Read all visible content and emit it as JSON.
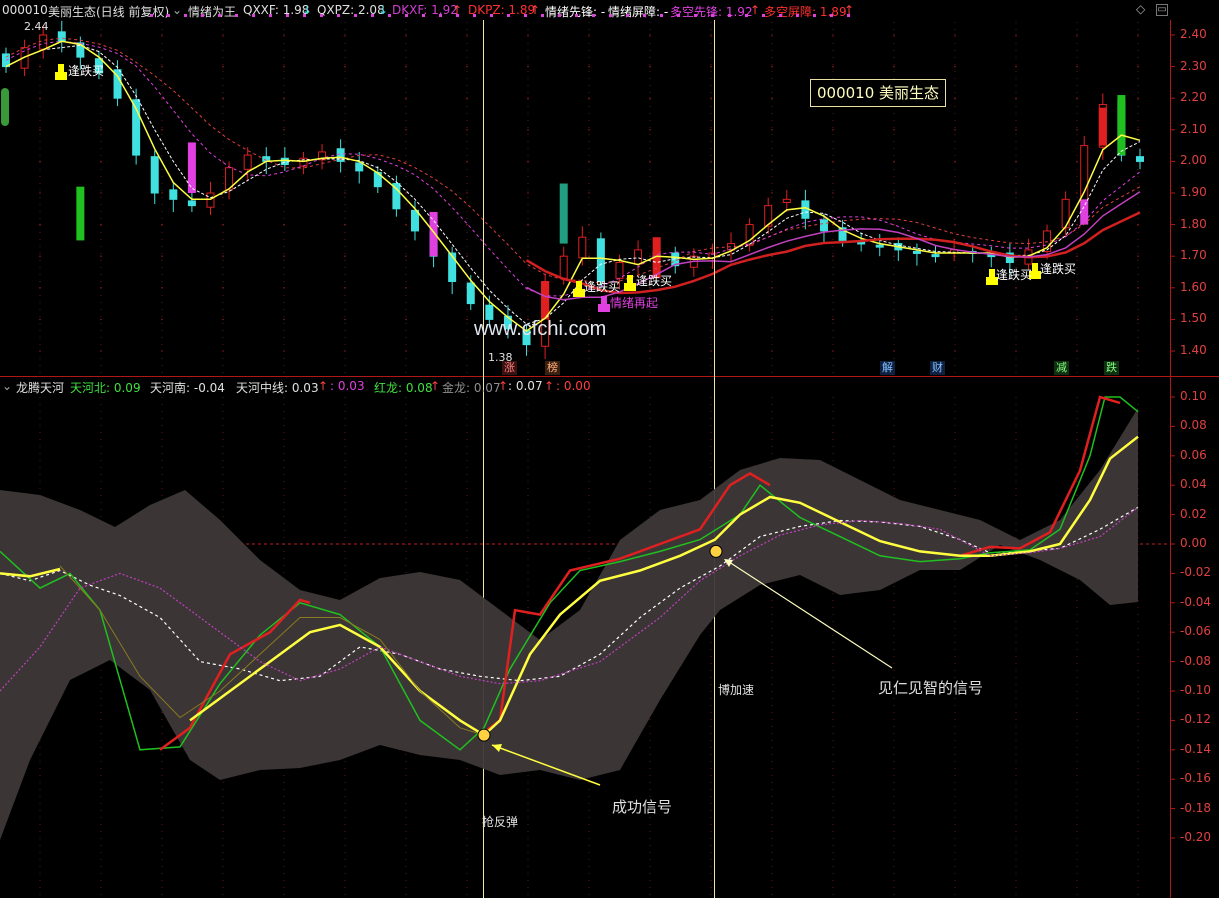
{
  "header": {
    "code": "000010",
    "name_mode": "美丽生态(日线 前复权)",
    "indicator_name": "情绪为王",
    "qxxf": "QXXF: 1.98",
    "qxpz": "QXPZ: 2.08",
    "dkxf": "DKXF: 1.92",
    "dkpz": "DKPZ: 1.89",
    "qxxf_arrow": "↓",
    "qxpz_arrow": "↓",
    "dkxf_arrow": "↑",
    "dkpz_arrow": "↑",
    "qxxf_lead": "情绪先锋: -",
    "qx_barrier": "情绪屏障: -",
    "dk_lead": "多空先锋: 1.92",
    "dk_lead_arrow": "↑",
    "dk_barrier": "多空屏障: 1.89",
    "dk_barrier_arrow": "↑"
  },
  "stock_box": "000010 美丽生态",
  "watermark": "www.cfchi.com",
  "upper_axis": [
    "2.40",
    "2.30",
    "2.20",
    "2.10",
    "2.00",
    "1.90",
    "1.80",
    "1.70",
    "1.60",
    "1.50",
    "1.40"
  ],
  "lower_axis": [
    "0.10",
    "0.08",
    "0.06",
    "0.04",
    "0.02",
    "0.00",
    "-0.02",
    "-0.04",
    "-0.06",
    "-0.08",
    "-0.10",
    "-0.12",
    "-0.14",
    "-0.16",
    "-0.18",
    "-0.20"
  ],
  "price_hi": "2.44",
  "price_lo": "1.38",
  "signals": {
    "buy1": "逢跌买",
    "buy2": "逢跌买",
    "buy3": "逢跌买",
    "buy4": "逢跌买",
    "buy5": "逢跌买",
    "restart": "情绪再起"
  },
  "event_marks": [
    "涨",
    "榜",
    "解",
    "财",
    "减",
    "跌"
  ],
  "lower_header": {
    "name": "龙腾天河",
    "thb": "天河北: 0.09",
    "thn": "天河南: -0.04",
    "thz": "天河中线: 0.03",
    "v1": ": 0.03",
    "hl": "红龙: 0.08",
    "jl": "金龙: 0.07",
    "v2": ": 0.07",
    "v3": ": 0.00"
  },
  "annotations": {
    "rebound": "抢反弹",
    "success": "成功信号",
    "accelerate": "博加速",
    "wise": "见仁见智的信号"
  },
  "colors": {
    "up": "#e02020",
    "down": "#40e0e0",
    "axis": "#b01818",
    "yellow": "#ffff40",
    "magenta": "#e040e0",
    "green": "#20c020",
    "band": "#3e3838"
  },
  "chart_data": [
    {
      "type": "candlestick",
      "title": "000010 美丽生态(日线 前复权)",
      "ylim": [
        1.38,
        2.44
      ],
      "visible_high": 2.44,
      "visible_low": 1.38,
      "series": [
        {
          "name": "QXXF",
          "last": 1.98
        },
        {
          "name": "QXPZ",
          "last": 2.08
        },
        {
          "name": "DKXF",
          "last": 1.92
        },
        {
          "name": "DKPZ",
          "last": 1.89
        }
      ],
      "close_approx": [
        2.3,
        2.36,
        2.4,
        2.38,
        2.33,
        2.28,
        2.2,
        2.02,
        1.9,
        1.88,
        1.86,
        1.9,
        1.98,
        2.02,
        2.0,
        1.99,
        2.01,
        2.03,
        2.0,
        1.97,
        1.92,
        1.85,
        1.78,
        1.7,
        1.62,
        1.55,
        1.5,
        1.47,
        1.42,
        1.62,
        1.7,
        1.76,
        1.62,
        1.68,
        1.72,
        1.7,
        1.67,
        1.7,
        1.71,
        1.74,
        1.8,
        1.86,
        1.88,
        1.82,
        1.78,
        1.75,
        1.74,
        1.73,
        1.72,
        1.71,
        1.7,
        1.72,
        1.71,
        1.7,
        1.68,
        1.72,
        1.78,
        1.88,
        2.05,
        2.18,
        2.02,
        2.0
      ]
    },
    {
      "type": "line",
      "title": "龙腾天河",
      "ylim": [
        -0.22,
        0.1
      ],
      "series": [
        {
          "name": "天河北",
          "last": 0.09
        },
        {
          "name": "天河南",
          "last": -0.04
        },
        {
          "name": "天河中线",
          "last": 0.03
        },
        {
          "name": "红龙",
          "last": 0.08
        },
        {
          "name": "金龙",
          "last": 0.07
        }
      ]
    }
  ]
}
